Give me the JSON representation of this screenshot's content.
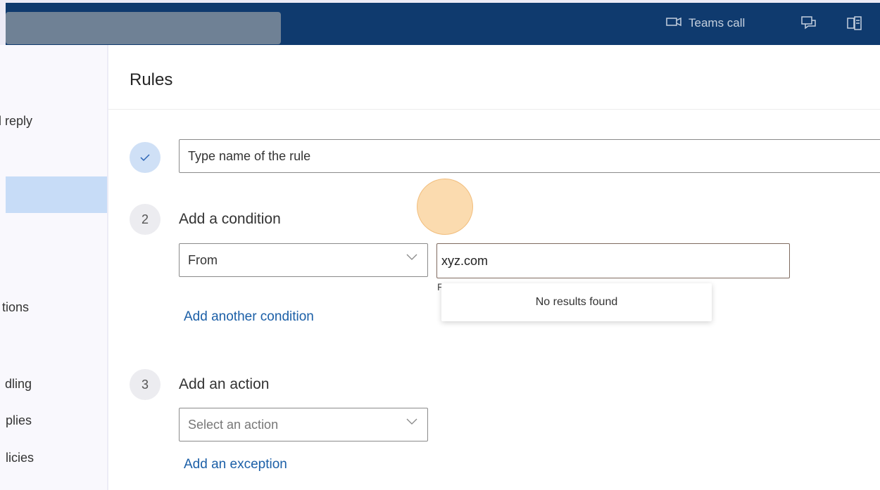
{
  "topbar": {
    "teams_call_label": "Teams call",
    "icons": [
      "video-icon",
      "chat-icon",
      "office-icon"
    ]
  },
  "leftnav": {
    "items": [
      "d reply",
      "tions",
      "dling",
      "plies",
      "licies"
    ]
  },
  "rules": {
    "title": "Rules",
    "name_placeholder": "Type name of the rule",
    "step2_number": "2",
    "step2_label": "Add a condition",
    "condition_field": "From",
    "condition_value": "xyz.com",
    "no_results": "No results found",
    "add_condition_link": "Add another condition",
    "step3_number": "3",
    "step3_label": "Add an action",
    "action_placeholder": "Select an action",
    "add_exception_link": "Add an exception"
  },
  "colors": {
    "topbar": "#0f3a6e",
    "link": "#1b5fa7",
    "selected_nav": "#c7dcf7"
  }
}
